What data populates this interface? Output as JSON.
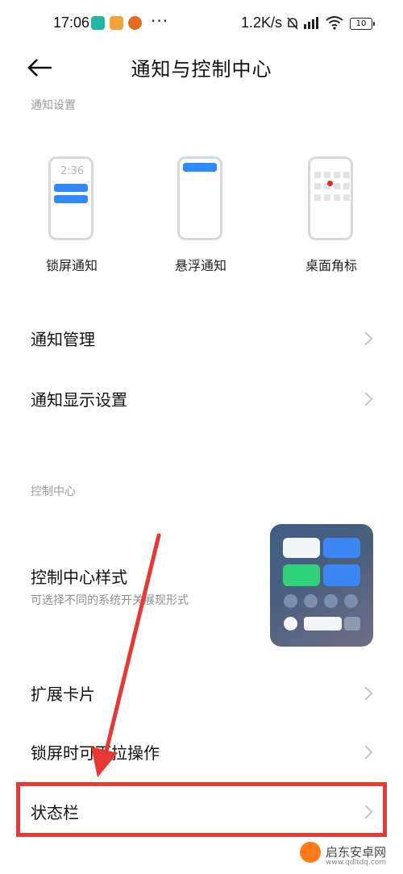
{
  "status_bar": {
    "time": "17:06",
    "dots": "···",
    "network_speed": "1.2K/s",
    "battery": "10"
  },
  "header": {
    "title": "通知与控制中心"
  },
  "notification_section": {
    "label": "通知设置",
    "previews": [
      {
        "label": "锁屏通知",
        "clock": "2:36"
      },
      {
        "label": "悬浮通知"
      },
      {
        "label": "桌面角标"
      }
    ]
  },
  "notification_rows": [
    {
      "title": "通知管理"
    },
    {
      "title": "通知显示设置"
    }
  ],
  "control_section": {
    "label": "控制中心",
    "style_row": {
      "title": "控制中心样式",
      "subtitle": "可选择不同的系统开关展现形式"
    },
    "rows": [
      {
        "title": "扩展卡片"
      },
      {
        "title": "锁屏时可下拉操作"
      },
      {
        "title": "状态栏"
      }
    ]
  },
  "colors": {
    "accent_blue": "#2f8bff",
    "highlight_red": "#e53935"
  },
  "watermark": {
    "name": "启东安卓网",
    "url": "www.qdltdq.com"
  }
}
